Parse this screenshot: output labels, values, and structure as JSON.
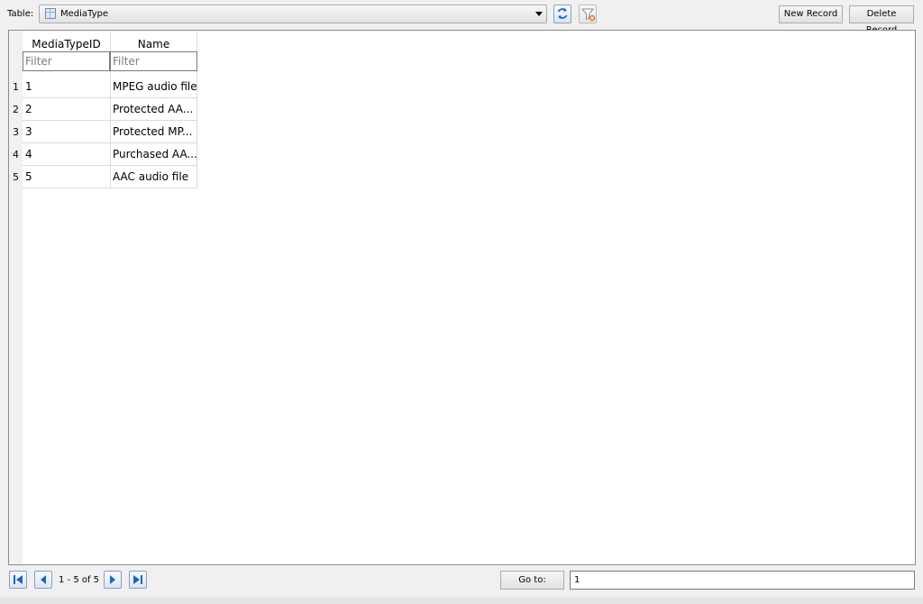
{
  "toolbar": {
    "table_label": "Table:",
    "selected_table": "MediaType",
    "refresh_icon": "refresh-icon",
    "clear_filter_icon": "clear-filter-icon",
    "new_record_label": "New Record",
    "delete_record_label": "Delete Record"
  },
  "grid": {
    "columns": [
      "MediaTypeID",
      "Name"
    ],
    "filter_placeholder": "Filter",
    "row_numbers": [
      "1",
      "2",
      "3",
      "4",
      "5"
    ],
    "rows": [
      [
        "1",
        "MPEG audio file"
      ],
      [
        "2",
        "Protected AA..."
      ],
      [
        "3",
        "Protected MP..."
      ],
      [
        "4",
        "Purchased AA..."
      ],
      [
        "5",
        "AAC audio file"
      ]
    ]
  },
  "navigation": {
    "page_info": "1 - 5 of 5",
    "goto_label": "Go to:",
    "goto_value": "1",
    "first_icon": "first-page-icon",
    "prev_icon": "previous-page-icon",
    "next_icon": "next-page-icon",
    "last_icon": "last-page-icon"
  },
  "colors": {
    "accent_blue": "#1d63c8",
    "grid_line": "#d9d9d9",
    "window_bg": "#f0f0f0"
  }
}
